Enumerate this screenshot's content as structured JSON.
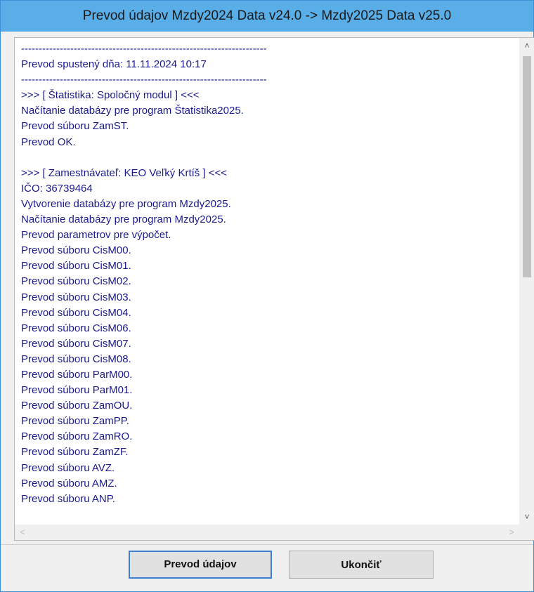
{
  "window": {
    "title": "Prevod údajov Mzdy2024 Data v24.0 ->  Mzdy2025 Data v25.0"
  },
  "log": {
    "lines": [
      "----------------------------------------------------------------------",
      "Prevod spustený dňa: 11.11.2024 10:17",
      "----------------------------------------------------------------------",
      ">>> [ Štatistika: Spoločný modul ] <<<",
      "Načítanie databázy pre program Štatistika2025.",
      "Prevod súboru ZamST.",
      "Prevod OK.",
      "",
      ">>> [ Zamestnávateľ: KEO Veľký Krtíš ] <<<",
      "IČO: 36739464",
      "Vytvorenie databázy pre program Mzdy2025.",
      "Načítanie databázy pre program Mzdy2025.",
      "Prevod parametrov pre výpočet.",
      "Prevod súboru CisM00.",
      "Prevod súboru CisM01.",
      "Prevod súboru CisM02.",
      "Prevod súboru CisM03.",
      "Prevod súboru CisM04.",
      "Prevod súboru CisM06.",
      "Prevod súboru CisM07.",
      "Prevod súboru CisM08.",
      "Prevod súboru ParM00.",
      "Prevod súboru ParM01.",
      "Prevod súboru ZamOU.",
      "Prevod súboru ZamPP.",
      "Prevod súboru ZamRO.",
      "Prevod súboru ZamZF.",
      "Prevod súboru AVZ.",
      "Prevod súboru AMZ.",
      "Prevod súboru ANP."
    ],
    "scroll_position": 0.0
  },
  "scrollbars": {
    "up_icon": "chevron-up-icon",
    "down_icon": "chevron-down-icon",
    "left_icon": "chevron-left-icon",
    "right_icon": "chevron-right-icon"
  },
  "buttons": {
    "convert_label": "Prevod údajov",
    "exit_label": "Ukončiť"
  },
  "colors": {
    "titlebar": "#5aaee8",
    "log_text": "#1a1a8c",
    "focus_border": "#3c7fd3"
  }
}
